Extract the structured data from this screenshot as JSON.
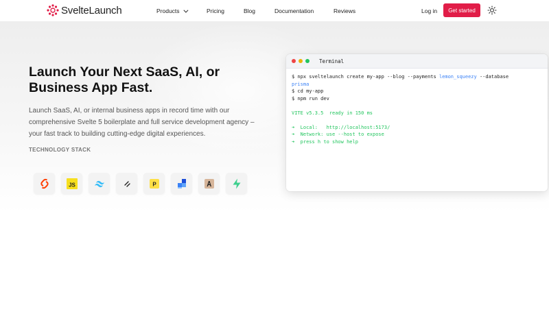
{
  "brand": {
    "name": "SvelteLaunch"
  },
  "nav": {
    "products": "Products",
    "pricing": "Pricing",
    "blog": "Blog",
    "documentation": "Documentation",
    "reviews": "Reviews",
    "login": "Log in",
    "cta": "Get started"
  },
  "hero": {
    "title_line1": "Launch Your Next SaaS, AI, or",
    "title_line2": "Business App Fast.",
    "description": "Launch SaaS, AI, or internal business apps in record time with our comprehensive Svelte 5 boilerplate and full service development agency – your fast track to building cutting-edge digital experiences.",
    "stack_label": "TECHNOLOGY STACK"
  },
  "tech_stack": [
    {
      "icon": "svelte-icon"
    },
    {
      "icon": "javascript-icon"
    },
    {
      "icon": "tailwind-icon"
    },
    {
      "icon": "shadcn-icon"
    },
    {
      "icon": "paddle-icon"
    },
    {
      "icon": "docker-blocks-icon"
    },
    {
      "icon": "anthropic-icon"
    },
    {
      "icon": "supabase-icon"
    }
  ],
  "terminal": {
    "title": "Terminal",
    "cmd1_pre": "$ npx sveltelaunch create my-app --blog --payments ",
    "cmd1_hl": "lemon_squeezy",
    "cmd1_post": " --database",
    "cmd1_hl2": "prisma",
    "cmd2": "$ cd my-app",
    "cmd3": "$ npm run dev",
    "vite": "VITE v5.3.5  ready in 150 ms",
    "local": "➜  Local:   http://localhost:5173/",
    "network": "➜  Network: use --host to expose",
    "help": "➜  press h to show help"
  },
  "colors": {
    "accent": "#e11d48",
    "terminal_green": "#22c55e",
    "terminal_blue": "#3b82f6"
  }
}
